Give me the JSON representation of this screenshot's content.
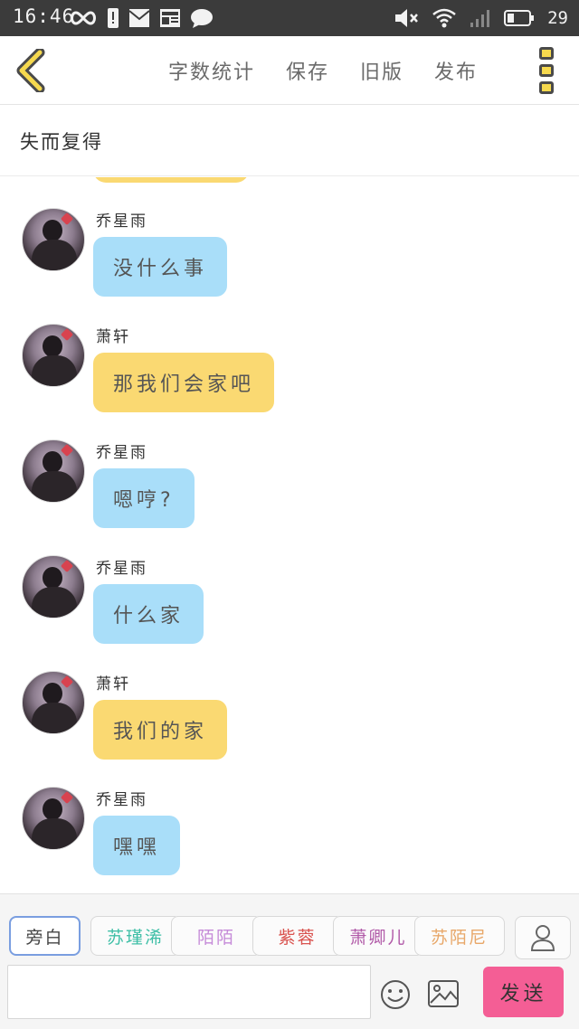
{
  "status_bar": {
    "time": "16:46",
    "battery_level": "29"
  },
  "toolbar": {
    "actions": [
      "字数统计",
      "保存",
      "旧版",
      "发布"
    ]
  },
  "header": {
    "title": "失而复得"
  },
  "messages": [
    {
      "sender": "乔星雨",
      "text": "没什么事",
      "color": "#a9def9"
    },
    {
      "sender": "萧轩",
      "text": "那我们会家吧",
      "color": "#fad972"
    },
    {
      "sender": "乔星雨",
      "text": "嗯哼?",
      "color": "#a9def9"
    },
    {
      "sender": "乔星雨",
      "text": "什么家",
      "color": "#a9def9"
    },
    {
      "sender": "萧轩",
      "text": "我们的家",
      "color": "#fad972"
    },
    {
      "sender": "乔星雨",
      "text": "嘿嘿",
      "color": "#a9def9"
    }
  ],
  "roles": [
    {
      "label": "旁白",
      "color": "#444444",
      "active": true
    },
    {
      "label": "苏瑾浠",
      "color": "#3fbfa7",
      "active": false
    },
    {
      "label": "陌陌",
      "color": "#c58ad8",
      "active": false
    },
    {
      "label": "紫蓉",
      "color": "#d9534f",
      "active": false
    },
    {
      "label": "萧卿儿",
      "color": "#b15aa8",
      "active": false
    },
    {
      "label": "苏陌尼",
      "color": "#e8a86a",
      "active": false
    }
  ],
  "composer": {
    "send_label": "发送",
    "input_value": ""
  },
  "icons": {
    "back": "chevron-left-icon",
    "more": "more-vertical-icon",
    "person": "person-icon",
    "emoji": "smiley-icon",
    "image": "image-icon"
  },
  "colors": {
    "accent_yellow": "#f6d94e",
    "bubble_blue": "#a9def9",
    "bubble_yellow": "#fad972",
    "send_pink": "#f45e95"
  }
}
